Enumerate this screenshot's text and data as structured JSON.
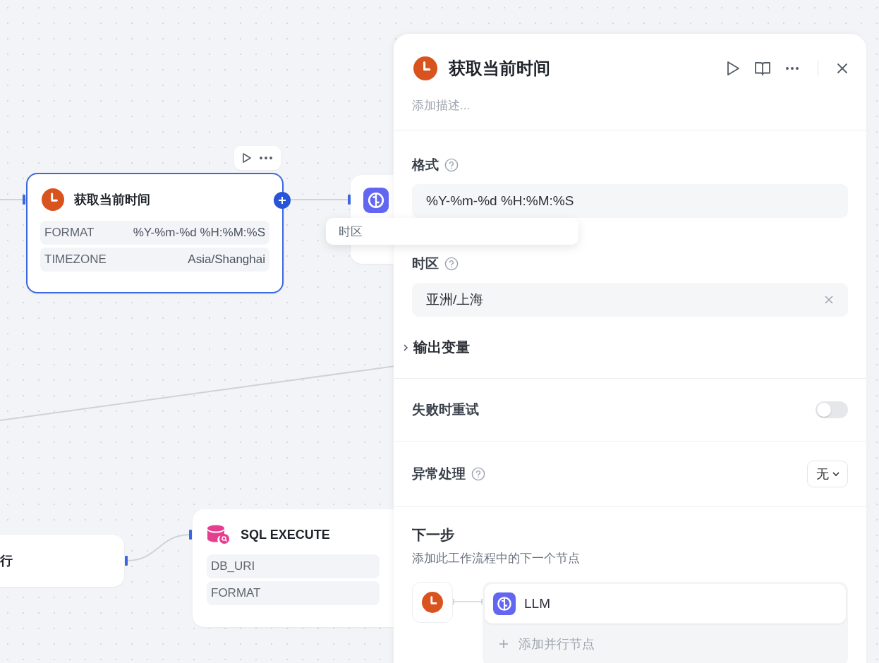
{
  "canvas": {
    "time_node": {
      "title": "获取当前时间",
      "selected": true,
      "params": [
        {
          "name": "FORMAT",
          "value": "%Y-%m-%d %H:%M:%S"
        },
        {
          "name": "TIMEZONE",
          "value": "Asia/Shanghai"
        }
      ]
    },
    "prev_node": {
      "title": "行"
    },
    "sql_node": {
      "title": "SQL EXECUTE",
      "params": [
        {
          "name": "DB_URI"
        },
        {
          "name": "FORMAT"
        }
      ]
    },
    "tooltip": {
      "text": "时区"
    }
  },
  "panel": {
    "title": "获取当前时间",
    "description": {
      "placeholder": "添加描述..."
    },
    "fields": [
      {
        "label": "格式",
        "value": "%Y-%m-%d %H:%M:%S",
        "clearable": false
      },
      {
        "label": "时区",
        "value": "亚洲/上海",
        "clearable": true
      }
    ],
    "output_section": {
      "label": "输出变量",
      "expanded": false
    },
    "retry": {
      "label": "失败时重试",
      "on": false
    },
    "error_handling": {
      "label": "异常处理",
      "value": "无"
    },
    "next_step": {
      "title": "下一步",
      "subtitle": "添加此工作流程中的下一个节点",
      "targets": [
        {
          "label": "LLM"
        }
      ],
      "add_parallel": "添加并行节点"
    }
  }
}
